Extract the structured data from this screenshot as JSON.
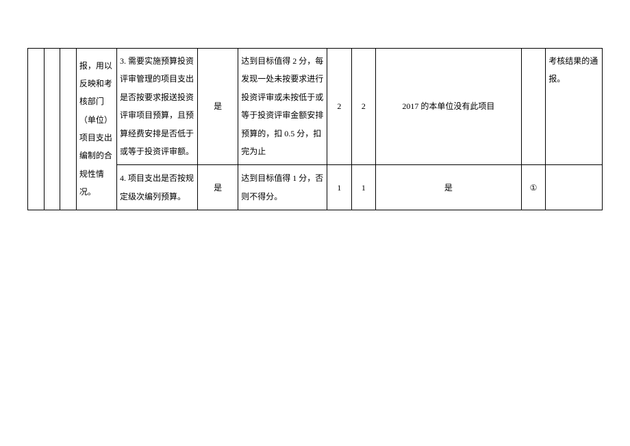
{
  "table": {
    "col_d_text": "报，用以反映和考核部门（单位）项目支出编制的合规性情况。",
    "rows": [
      {
        "criteria": "3. 需要实施预算投资评审管理的项目支出是否按要求报送投资评审项目预算，且预算经费安排是否低于或等于投资评审额。",
        "target": "是",
        "scoring": "达到目标值得 2 分，每发现一处未按要求进行投资评审或未按低于或等于投资评审金额安排预算的，扣 0.5 分，扣完为止",
        "score_a": "2",
        "score_b": "2",
        "result": "2017 的本单位没有此项目",
        "mark": "",
        "note": "考核结果的通报。"
      },
      {
        "criteria": "4. 项目支出是否按规定级次编列预算。",
        "target": "是",
        "scoring": "达到目标值得 1 分，否则不得分。",
        "score_a": "1",
        "score_b": "1",
        "result": "是",
        "mark": "①",
        "note": ""
      }
    ]
  }
}
